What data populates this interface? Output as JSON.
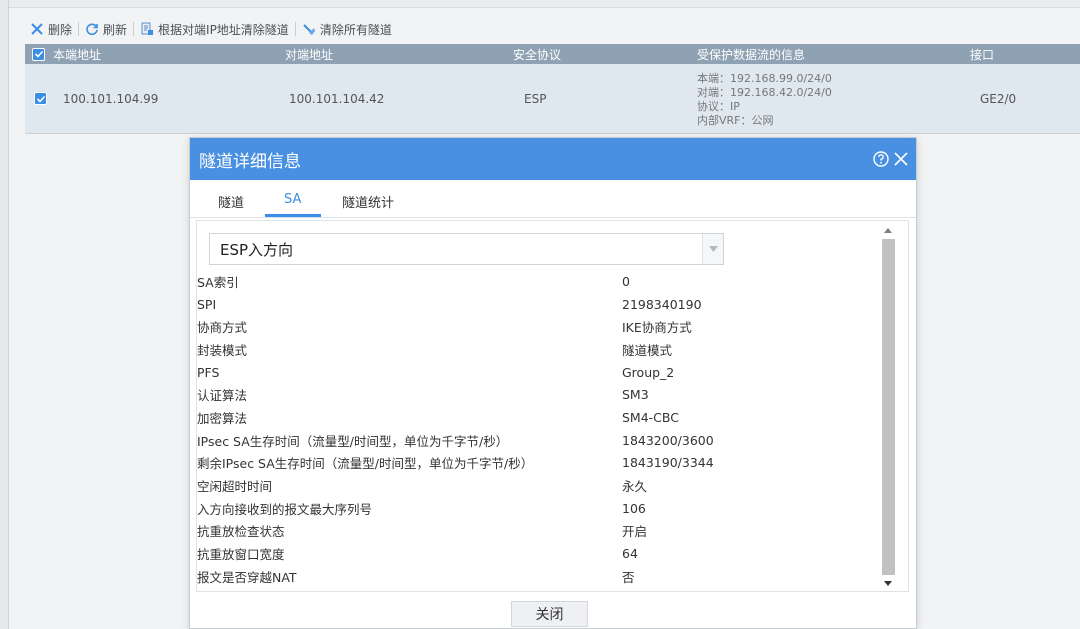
{
  "toolbar": {
    "delete_label": "删除",
    "refresh_label": "刷新",
    "clear_by_ip_label": "根据对端IP地址清除隧道",
    "clear_all_label": "清除所有隧道"
  },
  "table": {
    "headers": [
      "本端地址",
      "对端地址",
      "安全协议",
      "受保护数据流的信息",
      "接口"
    ],
    "row": {
      "local": "100.101.104.99",
      "peer": "100.101.104.42",
      "protocol": "ESP",
      "protected_lines": [
        "本端：192.168.99.0/24/0",
        "对端：192.168.42.0/24/0",
        "协议：IP",
        "内部VRF：公网"
      ],
      "interface": "GE2/0"
    }
  },
  "dialog": {
    "title": "隧道详细信息",
    "tabs": [
      "隧道",
      "SA",
      "隧道统计"
    ],
    "active_tab": "SA",
    "direction": "ESP入方向",
    "rows": [
      {
        "k": "SA索引",
        "v": "0"
      },
      {
        "k": "SPI",
        "v": "2198340190"
      },
      {
        "k": "协商方式",
        "v": "IKE协商方式"
      },
      {
        "k": "封装模式",
        "v": "隧道模式"
      },
      {
        "k": "PFS",
        "v": "Group_2"
      },
      {
        "k": "认证算法",
        "v": "SM3"
      },
      {
        "k": "加密算法",
        "v": "SM4-CBC"
      },
      {
        "k": "IPsec SA生存时间（流量型/时间型，单位为千字节/秒）",
        "v": "1843200/3600"
      },
      {
        "k": "剩余IPsec SA生存时间（流量型/时间型，单位为千字节/秒）",
        "v": "1843190/3344"
      },
      {
        "k": "空闲超时时间",
        "v": "永久"
      },
      {
        "k": "入方向接收到的报文最大序列号",
        "v": "106"
      },
      {
        "k": "抗重放检查状态",
        "v": "开启"
      },
      {
        "k": "抗重放窗口宽度",
        "v": "64"
      },
      {
        "k": "报文是否穿越NAT",
        "v": "否"
      }
    ],
    "close_label": "关闭"
  },
  "colors": {
    "header_blue": "#4a90e2",
    "accent": "#3a8ee6",
    "table_header": "#8fa2b3",
    "row_bg": "#dfe7ef"
  }
}
